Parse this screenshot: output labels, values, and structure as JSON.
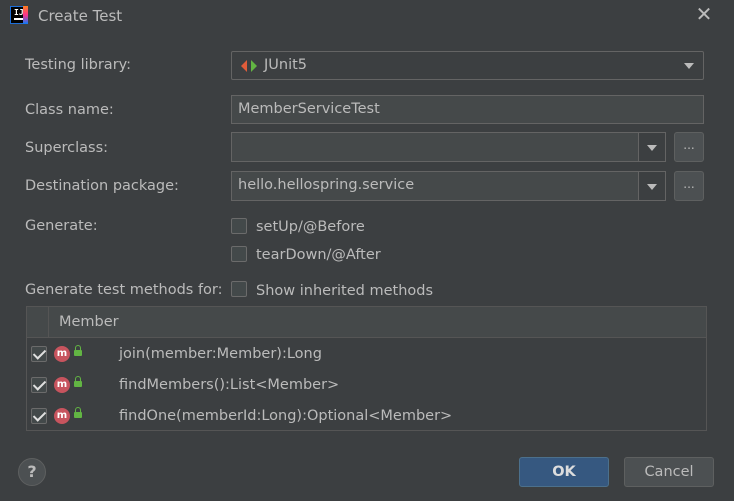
{
  "window": {
    "title": "Create Test",
    "app_icon": "intellij-icon",
    "close_icon": "close-icon"
  },
  "form": {
    "testing_library": {
      "label": "Testing library:",
      "value": "JUnit5",
      "icon": "junit-icon"
    },
    "class_name": {
      "label": "Class name:",
      "value": "MemberServiceTest"
    },
    "superclass": {
      "label": "Superclass:",
      "value": "",
      "browse": "..."
    },
    "destination_package": {
      "label": "Destination package:",
      "value": "hello.hellospring.service",
      "browse": "..."
    },
    "generate": {
      "label": "Generate:",
      "options": [
        {
          "label": "setUp/@Before",
          "checked": false
        },
        {
          "label": "tearDown/@After",
          "checked": false
        }
      ]
    },
    "methods_for": {
      "label": "Generate test methods for:",
      "show_inherited": {
        "label": "Show inherited methods",
        "checked": false
      }
    }
  },
  "table": {
    "header": "Member",
    "rows": [
      {
        "checked": true,
        "badge": "m",
        "signature": "join(member:Member):Long"
      },
      {
        "checked": true,
        "badge": "m",
        "signature": "findMembers():List<Member>"
      },
      {
        "checked": true,
        "badge": "m",
        "signature": "findOne(memberId:Long):Optional<Member>"
      }
    ]
  },
  "footer": {
    "help": "?",
    "ok": "OK",
    "cancel": "Cancel"
  },
  "colors": {
    "background": "#3c3f41",
    "ok_button": "#365880",
    "badge": "#c7545e",
    "lock": "#62b543"
  }
}
